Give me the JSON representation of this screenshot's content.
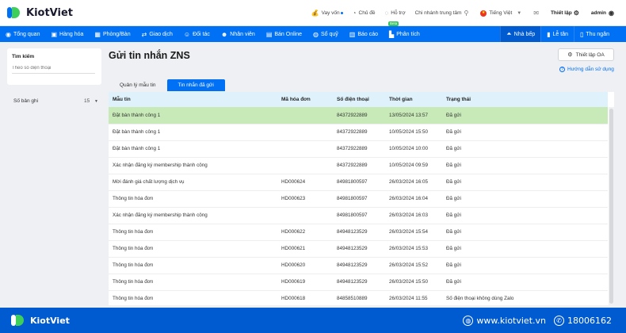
{
  "app": {
    "name": "KiotViet"
  },
  "topbar": {
    "loan": "Vay vốn",
    "topics": "Chủ đề",
    "support": "Hỗ trợ",
    "branch": "Chi nhánh trung tâm",
    "language": "Tiếng Việt",
    "settings": "Thiết lập",
    "user": "admin"
  },
  "nav": {
    "items": [
      {
        "label": "Tổng quan",
        "icon": "eye-icon"
      },
      {
        "label": "Hàng hóa",
        "icon": "box-icon"
      },
      {
        "label": "Phòng/Bàn",
        "icon": "table-icon"
      },
      {
        "label": "Giao dịch",
        "icon": "swap-icon"
      },
      {
        "label": "Đối tác",
        "icon": "partner-icon"
      },
      {
        "label": "Nhân viên",
        "icon": "staff-icon"
      },
      {
        "label": "Bán Online",
        "icon": "shop-icon"
      },
      {
        "label": "Sổ quỹ",
        "icon": "fund-icon"
      },
      {
        "label": "Báo cáo",
        "icon": "report-icon"
      },
      {
        "label": "Phân tích",
        "icon": "analytics-icon",
        "badge": "Beta"
      }
    ],
    "right": [
      {
        "label": "Nhà bếp",
        "icon": "kitchen-icon"
      },
      {
        "label": "Lễ tân",
        "icon": "reception-icon"
      },
      {
        "label": "Thu ngân",
        "icon": "cashier-icon"
      }
    ]
  },
  "sidebar": {
    "search_title": "Tìm kiếm",
    "search_placeholder": "Theo số điện thoại",
    "rows_label": "Số bản ghi",
    "rows_value": "15"
  },
  "main": {
    "title": "Gửi tin nhắn ZNS",
    "setup_oa": "Thiết lập OA",
    "help": "Hướng dẫn sử dụng",
    "tabs": [
      "Quản lý mẫu tin",
      "Tin nhắn đã gửi"
    ],
    "columns": [
      "Mẫu tin",
      "Mã hóa đơn",
      "Số điện thoại",
      "Thời gian",
      "Trạng thái"
    ],
    "rows": [
      [
        "Đặt bàn thành công 1",
        "",
        "84372922889",
        "13/05/2024 13:57",
        "Đã gửi"
      ],
      [
        "Đặt bàn thành công 1",
        "",
        "84372922889",
        "10/05/2024 15:50",
        "Đã gửi"
      ],
      [
        "Đặt bàn thành công 1",
        "",
        "84372922889",
        "10/05/2024 10:00",
        "Đã gửi"
      ],
      [
        "Xác nhận đăng ký membership thành công",
        "",
        "84372922889",
        "10/05/2024 09:59",
        "Đã gửi"
      ],
      [
        "Mời đánh giá chất lượng dịch vụ",
        "HD000624",
        "84981800597",
        "26/03/2024 16:05",
        "Đã gửi"
      ],
      [
        "Thông tin hóa đơn",
        "HD000623",
        "84981800597",
        "26/03/2024 16:04",
        "Đã gửi"
      ],
      [
        "Xác nhận đăng ký membership thành công",
        "",
        "84981800597",
        "26/03/2024 16:03",
        "Đã gửi"
      ],
      [
        "Thông tin hóa đơn",
        "HD000622",
        "84948123529",
        "26/03/2024 15:54",
        "Đã gửi"
      ],
      [
        "Thông tin hóa đơn",
        "HD000621",
        "84948123529",
        "26/03/2024 15:53",
        "Đã gửi"
      ],
      [
        "Thông tin hóa đơn",
        "HD000620",
        "84948123529",
        "26/03/2024 15:52",
        "Đã gửi"
      ],
      [
        "Thông tin hóa đơn",
        "HD000619",
        "84948123529",
        "26/03/2024 15:50",
        "Đã gửi"
      ],
      [
        "Thông tin hóa đơn",
        "HD000618",
        "84858510889",
        "26/03/2024 11:55",
        "Số điện thoại không dùng Zalo"
      ]
    ]
  },
  "footer": {
    "brand": "KiotViet",
    "website": "www.kiotviet.vn",
    "hotline": "18006162"
  },
  "colors": {
    "brand_blue": "#0070f4",
    "highlight_row": "#c8eab8",
    "header_row": "#dff2fb"
  }
}
